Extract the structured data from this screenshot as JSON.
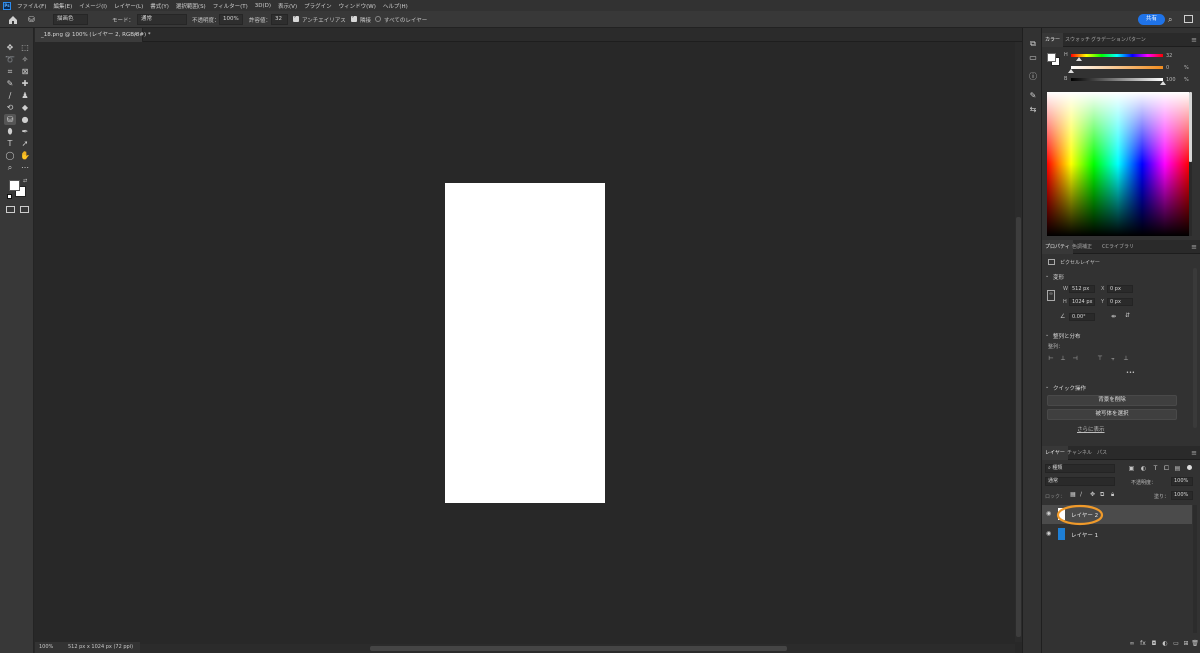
{
  "app": {
    "logo_text": "Ps"
  },
  "menu": [
    "ファイル(F)",
    "編集(E)",
    "イメージ(I)",
    "レイヤー(L)",
    "書式(Y)",
    "選択範囲(S)",
    "フィルター(T)",
    "3D(D)",
    "表示(V)",
    "プラグイン",
    "ウィンドウ(W)",
    "ヘルプ(H)"
  ],
  "options": {
    "fill_source": "描画色",
    "mode_label": "モード：",
    "mode_value": "通常",
    "opacity_label": "不透明度：",
    "opacity_value": "100%",
    "tolerance_label": "許容値：",
    "tolerance_value": "32",
    "antialias_label": "アンチエイリアス",
    "contiguous_label": "隣接",
    "all_layers_label": "すべてのレイヤー",
    "share_label": "共有"
  },
  "document": {
    "tab_title": "_18.png @ 100% (レイヤー 2, RGB/8#) *",
    "close_glyph": "×",
    "zoom": "100%",
    "size_info": "512 px x 1024 px (72 ppi)"
  },
  "color_panel": {
    "tabs": [
      "カラー",
      "スウォッチ",
      "グラデーション",
      "パターン"
    ],
    "h_label": "H",
    "h_value": "32",
    "s_value": "0",
    "s_unit": "%",
    "b_label": "B",
    "b_value": "100",
    "b_unit": "%",
    "h_fraction": 0.09,
    "s_fraction": 0.0,
    "b_fraction": 1.0
  },
  "properties_panel": {
    "tabs": [
      "プロパティ",
      "色調補正",
      "CCライブラリ"
    ],
    "layer_type": "ピクセルレイヤー",
    "transform_title": "変形",
    "w_label": "W",
    "w_value": "512 px",
    "h_label": "H",
    "h_value": "1024 px",
    "x_label": "X",
    "x_value": "0 px",
    "y_label": "Y",
    "y_value": "0 px",
    "angle_value": "0.00°",
    "align_title": "整列と分布",
    "align_sub": "整列：",
    "more": "•••",
    "quick_title": "クイック操作",
    "remove_bg": "背景を削除",
    "select_subject": "被写体を選択",
    "show_more": "さらに表示"
  },
  "layers_panel": {
    "tabs": [
      "レイヤー",
      "チャンネル",
      "パス"
    ],
    "filter_kind": "種類",
    "blend_mode": "通常",
    "opacity_label": "不透明度：",
    "opacity_value": "100%",
    "lock_label": "ロック：",
    "fill_label": "塗り：",
    "fill_value": "100%",
    "layers": [
      {
        "name": "レイヤー 2",
        "selected": true
      },
      {
        "name": "レイヤー 1",
        "selected": false
      }
    ]
  },
  "colors": {
    "accent": "#1f73e8",
    "highlight_circle": "#f09a2a",
    "layer1_thumb": "#1e7fd6"
  }
}
